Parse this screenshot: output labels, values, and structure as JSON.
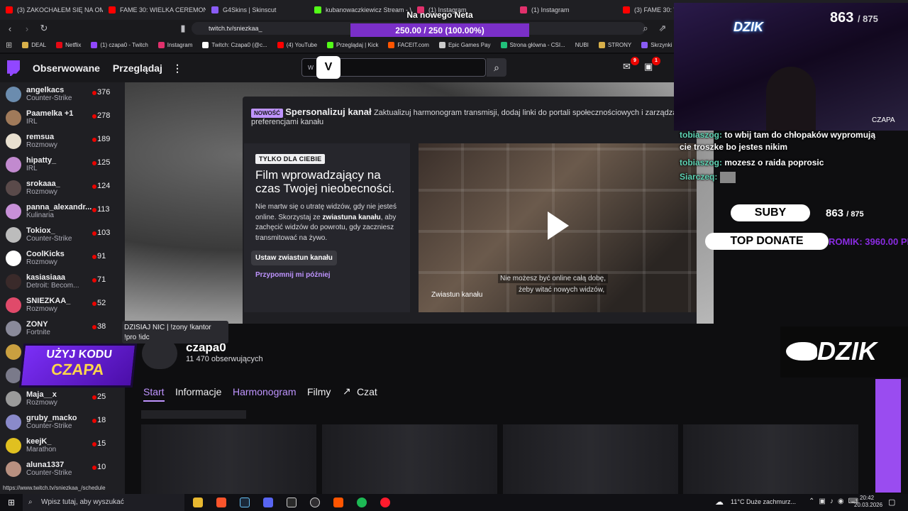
{
  "browser": {
    "tabs": [
      {
        "label": "(3) ZAKOCHAŁEM SIĘ NA OME",
        "icon": "youtube-icon",
        "color": "#ff0000"
      },
      {
        "label": "FAME 30: WIELKA CEREMONIA",
        "icon": "youtube-icon",
        "color": "#ff0000"
      },
      {
        "label": "G4Skins | Skinscut",
        "icon": "g4skins-icon",
        "color": "#8a5cf6"
      },
      {
        "label": "kubanowaczkiewicz Stream - W",
        "icon": "kick-icon",
        "color": "#53fc18"
      },
      {
        "label": "(1) Instagram",
        "icon": "instagram-icon",
        "color": "#e1306c"
      },
      {
        "label": "(1) Instagram",
        "icon": "instagram-icon",
        "color": "#e1306c"
      },
      {
        "label": "(3) FAME 30: WIELKA",
        "icon": "youtube-icon",
        "color": "#ff0000"
      }
    ],
    "url": "twitch.tv/sniezkaa_",
    "bookmarks": [
      {
        "label": "DEAL",
        "color": "#d8b04a"
      },
      {
        "label": "Netflix",
        "color": "#e50914"
      },
      {
        "label": "(1) czapa0 - Twitch",
        "color": "#9147ff"
      },
      {
        "label": "Instagram",
        "color": "#e1306c"
      },
      {
        "label": "Twitch: Czapa0 (@c...",
        "color": "#ffffff"
      },
      {
        "label": "(4) YouTube",
        "color": "#ff0000"
      },
      {
        "label": "Przeglądaj | Kick",
        "color": "#53fc18"
      },
      {
        "label": "FACEIT.com",
        "color": "#ff5500"
      },
      {
        "label": "Epic Games Pay",
        "color": "#cccccc"
      },
      {
        "label": "Strona główna - CSI...",
        "color": "#21c07a"
      },
      {
        "label": "NUBI",
        "color": "#555555"
      },
      {
        "label": "STRONY",
        "color": "#d8b04a"
      },
      {
        "label": "Skrzynki CS:...",
        "color": "#8a5cf6"
      }
    ],
    "status_url": "https://www.twitch.tv/sniezkaa_/schedule"
  },
  "goal": {
    "title": "Na nowego Neta",
    "progress_text": "250.00 / 250 (100.00%)",
    "progress": 1.0
  },
  "topnav": {
    "following": "Obserwowane",
    "browse": "Przeglądaj",
    "search_value": "w",
    "notif_count": "9",
    "inbox_count": "1"
  },
  "sidebar": {
    "channels": [
      {
        "name": "angelkacs",
        "category": "Counter-Strike",
        "viewers": "376",
        "color": "#6b8cae"
      },
      {
        "name": "Paamelka +1",
        "category": "IRL",
        "viewers": "278",
        "color": "#a07a5a"
      },
      {
        "name": "remsua",
        "category": "Rozmowy",
        "viewers": "189",
        "color": "#e8e0d0"
      },
      {
        "name": "hipatty_",
        "category": "IRL",
        "viewers": "125",
        "color": "#c28acf"
      },
      {
        "name": "srokaaa_",
        "category": "Rozmowy",
        "viewers": "124",
        "color": "#5a4a4a"
      },
      {
        "name": "panna_alexandr...",
        "category": "Kulinaria",
        "viewers": "113",
        "color": "#c890d8"
      },
      {
        "name": "Tokiox_",
        "category": "Counter-Strike",
        "viewers": "103",
        "color": "#bcbcbc"
      },
      {
        "name": "CoolKicks",
        "category": "Rozmowy",
        "viewers": "91",
        "color": "#ffffff"
      },
      {
        "name": "kasiasiaaa",
        "category": "Detroit: Becom...",
        "viewers": "71",
        "color": "#3a2a2a"
      },
      {
        "name": "SNIEZKAA_",
        "category": "Rozmowy",
        "viewers": "52",
        "color": "#e04a6a"
      },
      {
        "name": "ZONY",
        "category": "Fortnite",
        "viewers": "38",
        "color": "#8a8a9a"
      },
      {
        "name": "",
        "category": "",
        "viewers": "",
        "color": "#caa040"
      },
      {
        "name": "",
        "category": "",
        "viewers": "",
        "color": "#7a7a8a"
      },
      {
        "name": "Maja__x",
        "category": "Rozmowy",
        "viewers": "25",
        "color": "#9a9a9a"
      },
      {
        "name": "gruby_macko",
        "category": "Counter-Strike",
        "viewers": "18",
        "color": "#8a8aca"
      },
      {
        "name": "keejK_",
        "category": "Marathon",
        "viewers": "15",
        "color": "#e0c020"
      },
      {
        "name": "aluna1337",
        "category": "Counter-Strike",
        "viewers": "10",
        "color": "#b89080"
      }
    ]
  },
  "notice": {
    "badge": "NOWOŚĆ",
    "title": "Spersonalizuj kanał",
    "text": "Zaktualizuj harmonogram transmisji, dodaj linki do portali społecznościowych i zarządzaj",
    "text2": "preferencjami kanału",
    "card_tag": "TYLKO DLA CIEBIE",
    "card_title": "Film wprowadzający na czas Twojej nieobecności.",
    "card_body_1": "Nie martw się o utratę widzów, gdy nie jesteś online. Skorzystaj ze ",
    "card_body_bold": "zwiastuna kanału",
    "card_body_2": ", aby zachęcić widzów do powrotu, gdy zaczniesz transmitować na żywo.",
    "set_trailer_button": "Ustaw zwiastun kanału",
    "remind_later": "Przypomnij mi później",
    "video_caption": "Zwiastun kanału",
    "video_subtitle_1": "Nie możesz być online całą dobę,",
    "video_subtitle_2": "żeby witać nowych widzów,"
  },
  "channel": {
    "name": "czapa0",
    "followers": "11 470 obserwujących",
    "tabs": [
      "Start",
      "Informacje",
      "Harmonogram",
      "Filmy",
      "Czat"
    ],
    "active_tab": "Start",
    "hover_tab": "Harmonogram"
  },
  "tooltip": {
    "line1": "DZISIAJ NIC | !zony !kantor",
    "line2": "!pro !idc"
  },
  "overlay": {
    "sub_current": "863",
    "sub_goal": "/ 875",
    "streamer_tag": "CZAPA",
    "dzik_logo": "DZIK",
    "code_line1": "UŻYJ KODU",
    "code_line2": "CZAPA",
    "suby_label": "SUBY",
    "suby_value": "863",
    "suby_goal": "/ 875",
    "top_donate_label": "TOP DONATE",
    "top_donate_value": "ROMIK: 3960.00 PLN",
    "chat": [
      {
        "user": "tobiaszog:",
        "text": "to wbij tam do chłopaków wypromują cie troszke bo jestes nikim"
      },
      {
        "user": "tobiaszog:",
        "text": "mozesz o raida poprosic"
      },
      {
        "user": "Siarczeq:",
        "text": ""
      }
    ]
  },
  "taskbar": {
    "search_placeholder": "Wpisz tutaj, aby wyszukać",
    "weather": "11°C  Duże zachmurz...",
    "time": "20:42",
    "date": "20.03.2026"
  },
  "colors": {
    "twitch_purple": "#9147ff",
    "link_purple": "#bf94ff",
    "live_red": "#eb0400"
  }
}
